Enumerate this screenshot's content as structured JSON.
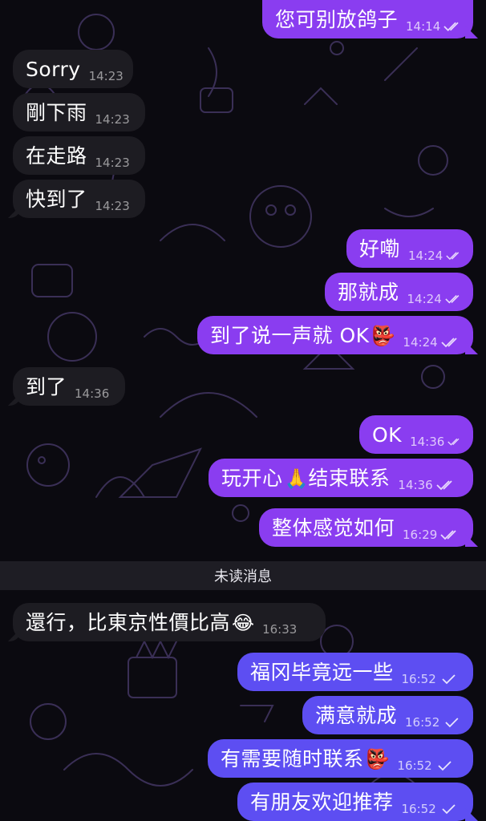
{
  "messages": [
    {
      "text": "您可别放鸽子",
      "time": "14:14",
      "dir": "out"
    },
    {
      "text": "Sorry",
      "time": "14:23",
      "dir": "in"
    },
    {
      "text": "剛下雨",
      "time": "14:23",
      "dir": "in"
    },
    {
      "text": "在走路",
      "time": "14:23",
      "dir": "in"
    },
    {
      "text": "快到了",
      "time": "14:23",
      "dir": "in"
    },
    {
      "text": "好嘞",
      "time": "14:24",
      "dir": "out"
    },
    {
      "text": "那就成",
      "time": "14:24",
      "dir": "out"
    },
    {
      "text": "到了说一声就 OK",
      "time": "14:24",
      "dir": "out",
      "emoji": "kabuki-mask"
    },
    {
      "text": "到了",
      "time": "14:36",
      "dir": "in"
    },
    {
      "text": "OK",
      "time": "14:36",
      "dir": "out"
    },
    {
      "text_before": "玩开心",
      "text_after": "结束联系",
      "time": "14:36",
      "dir": "out",
      "emoji": "folded-hands"
    },
    {
      "text": "整体感觉如何",
      "time": "16:29",
      "dir": "out"
    },
    {
      "text": "還行，比東京性價比高",
      "time": "16:33",
      "dir": "in",
      "emoji": "tears-of-joy"
    },
    {
      "text": "福冈毕竟远一些",
      "time": "16:52",
      "dir": "out"
    },
    {
      "text": "满意就成",
      "time": "16:52",
      "dir": "out"
    },
    {
      "text": "有需要随时联系",
      "time": "16:52",
      "dir": "out",
      "emoji": "kabuki-mask"
    },
    {
      "text": "有朋友欢迎推荐",
      "time": "16:52",
      "dir": "out"
    }
  ],
  "unread_divider": "未读消息",
  "colors": {
    "background": "#0b0a10",
    "incoming_bubble": "#1d1c22",
    "outgoing_bubble": "#8a3df0",
    "outgoing_bubble_blue": "#5d4ef2"
  },
  "icons": {
    "read": "double-check-icon",
    "sent": "single-check-icon"
  }
}
